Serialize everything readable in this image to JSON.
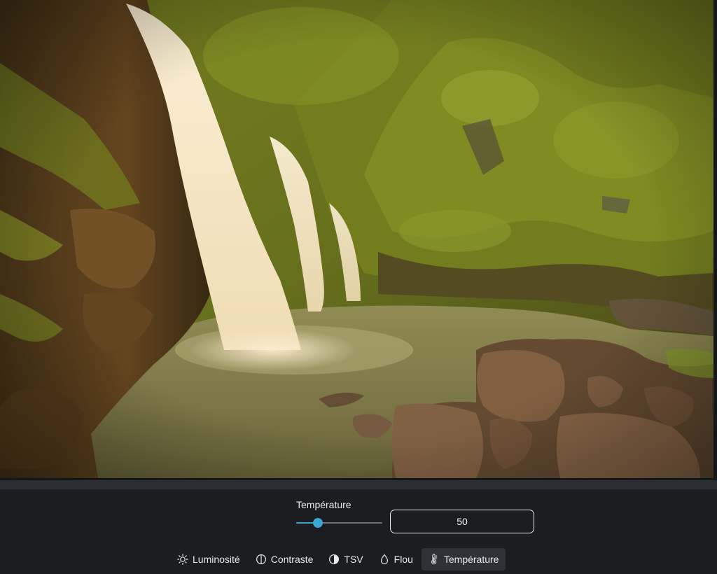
{
  "editor": {
    "image_alt": "Waterfall flowing into a rocky pool surrounded by mossy cliffs"
  },
  "adjust": {
    "label": "Température",
    "value": "50",
    "min": 0,
    "max": 100,
    "level": 0.25
  },
  "colors": {
    "accent": "#3aa6d4",
    "panel": "#1b1d20",
    "text": "#e8eaed"
  },
  "toolbar": {
    "tools": [
      {
        "label": "Luminosité",
        "icon": "sun-icon"
      },
      {
        "label": "Contraste",
        "icon": "contrast-icon"
      },
      {
        "label": "TSV",
        "icon": "half-circle-icon"
      },
      {
        "label": "Flou",
        "icon": "droplet-icon"
      },
      {
        "label": "Température",
        "icon": "thermometer-icon",
        "active": true
      }
    ]
  }
}
